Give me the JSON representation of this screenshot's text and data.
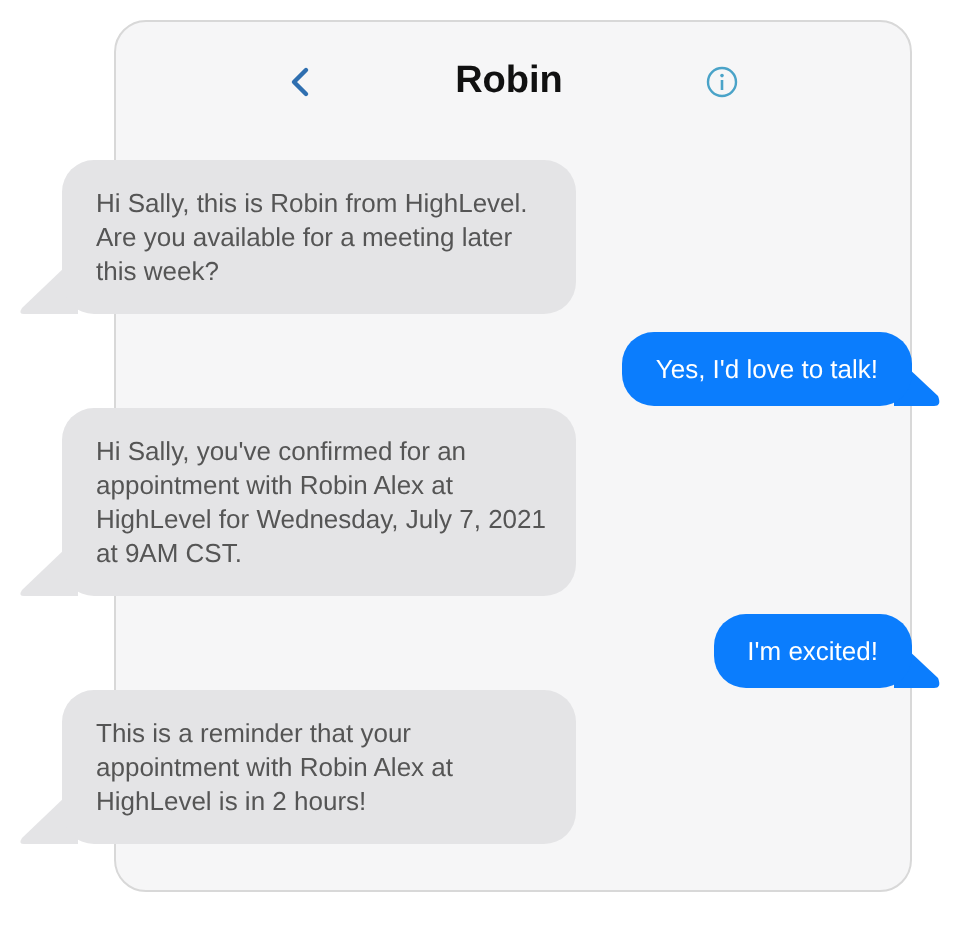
{
  "header": {
    "title": "Robin"
  },
  "messages": [
    {
      "kind": "received",
      "text": "Hi Sally, this is Robin from HighLevel. Are you available for a meeting later this week?"
    },
    {
      "kind": "sent",
      "text": "Yes, I'd love to talk!"
    },
    {
      "kind": "received",
      "text": "Hi Sally, you've confirmed for an appointment with Robin Alex at HighLevel for Wednesday, July 7, 2021 at 9AM CST."
    },
    {
      "kind": "sent",
      "text": "I'm excited!"
    },
    {
      "kind": "received",
      "text": "This is a reminder that your appointment with Robin Alex at HighLevel is in 2 hours!"
    }
  ]
}
